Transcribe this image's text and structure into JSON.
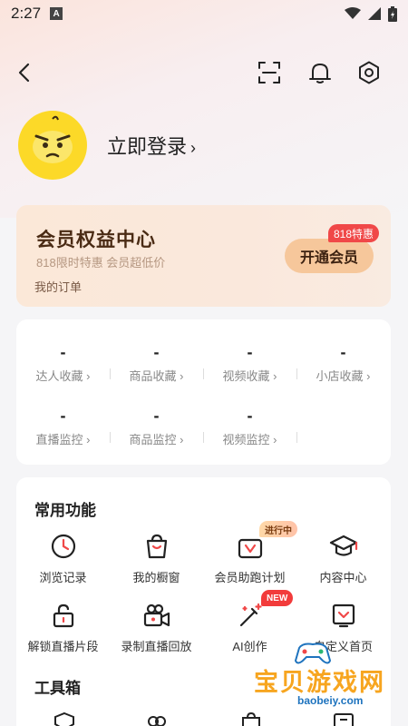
{
  "status_bar": {
    "time": "2:27",
    "indicator": "A"
  },
  "top_bar": {
    "icons": [
      "back-icon",
      "scan-icon",
      "bell-icon",
      "settings-icon"
    ]
  },
  "profile": {
    "login_label": "立即登录",
    "chevron": "›"
  },
  "vip": {
    "title": "会员权益中心",
    "subtitle": "818限时特惠 会员超低价",
    "orders_link": "我的订单",
    "open_button": "开通会员",
    "badge": "818特惠"
  },
  "favorites": {
    "row1": [
      {
        "value": "-",
        "label": "达人收藏 ›"
      },
      {
        "value": "-",
        "label": "商品收藏 ›"
      },
      {
        "value": "-",
        "label": "视频收藏 ›"
      },
      {
        "value": "-",
        "label": "小店收藏 ›"
      }
    ],
    "row2": [
      {
        "value": "-",
        "label": "直播监控 ›"
      },
      {
        "value": "-",
        "label": "商品监控 ›"
      },
      {
        "value": "-",
        "label": "视频监控 ›"
      }
    ]
  },
  "common_functions": {
    "title": "常用功能",
    "row1": [
      {
        "label": "浏览记录",
        "icon": "clock-icon"
      },
      {
        "label": "我的橱窗",
        "icon": "shopping-bag-icon"
      },
      {
        "label": "会员助跑计划",
        "icon": "vip-plan-icon",
        "tag": "进行中"
      },
      {
        "label": "内容中心",
        "icon": "graduation-cap-icon"
      }
    ],
    "row2": [
      {
        "label": "解锁直播片段",
        "icon": "unlock-icon"
      },
      {
        "label": "录制直播回放",
        "icon": "video-camera-icon"
      },
      {
        "label": "AI创作",
        "icon": "magic-wand-icon",
        "tag": "NEW"
      },
      {
        "label": "自定义首页",
        "icon": "custom-home-icon"
      }
    ]
  },
  "toolbox": {
    "title": "工具箱"
  },
  "watermark": {
    "text": "宝贝游戏网",
    "url": "baobeiy.com"
  },
  "colors": {
    "accent_red": "#f04848",
    "vip_gold": "#f6c79b",
    "avatar_yellow": "#fcd928"
  }
}
